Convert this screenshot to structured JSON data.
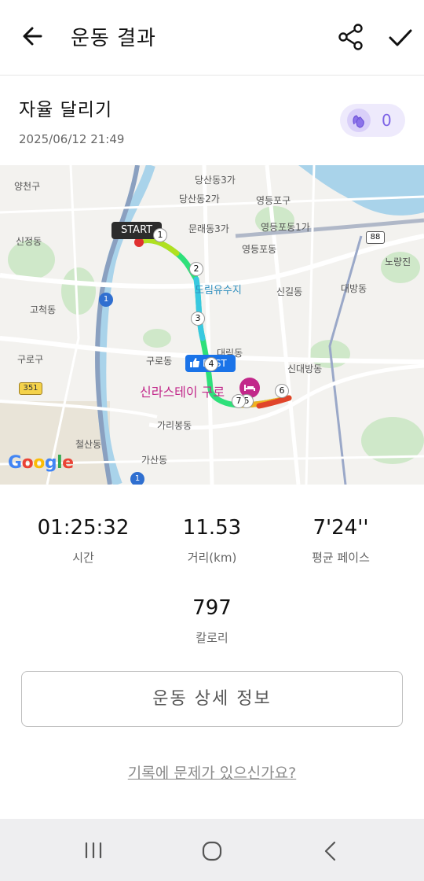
{
  "header": {
    "title": "운동 결과",
    "back_icon": "arrow-left-icon",
    "share_icon": "share-icon",
    "done_icon": "check-icon"
  },
  "activity": {
    "name": "자율 달리기",
    "datetime": "2025/06/12 21:49",
    "likes_count": "0",
    "likes_icon": "clap-hands-icon",
    "likes_accent": "#7d63e6"
  },
  "map": {
    "start_label": "START",
    "best_label": "BEST",
    "poi_label": "신라스테이 구로",
    "google_logo": "Google",
    "route_shield": "88",
    "road_shield": "351",
    "route_marker_1": "1",
    "km_markers": [
      "1",
      "2",
      "3",
      "4",
      "5",
      "6",
      "7"
    ],
    "places": {
      "yangcheon": "양천구",
      "sinjeong": "신정동",
      "gocheok": "고척동",
      "guro_gu": "구로구",
      "cheolsan": "철산동",
      "gasan": "가산동",
      "garibong": "가리봉동",
      "guro_dong": "구로동",
      "daerim": "대림동",
      "dorim": "도림유수지",
      "mullae": "문래동3가",
      "dangsan2": "당산동2가",
      "dangsan3": "당산동3가",
      "yeongdeungpo_gu": "영등포구",
      "yeongdeungpo_dong": "영등포동",
      "yeongdeungpo_1ga": "영등포동1가",
      "singil": "신길동",
      "daebang": "대방동",
      "sindaebang": "신대방동",
      "noryangjin": "노량진"
    }
  },
  "stats": {
    "time_value": "01:25:32",
    "time_label": "시간",
    "distance_value": "11.53",
    "distance_label": "거리(km)",
    "pace_value": "7'24''",
    "pace_label": "평균 페이스",
    "calories_value": "797",
    "calories_label": "칼로리"
  },
  "actions": {
    "detail_button": "운동 상세 정보",
    "report_link": "기록에 문제가 있으신가요?"
  },
  "system_nav": {
    "recent_icon": "recent-apps-icon",
    "home_icon": "home-icon",
    "back_icon": "nav-back-icon"
  }
}
